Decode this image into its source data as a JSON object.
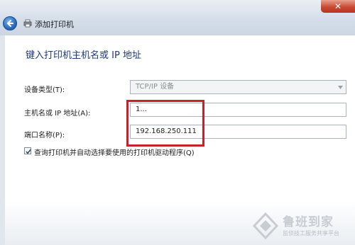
{
  "window": {
    "title": "添加打印机",
    "close_glyph": "✕"
  },
  "page": {
    "heading": "键入打印机主机名或 IP 地址"
  },
  "form": {
    "device_type": {
      "label": "设备类型(T):",
      "value": "TCP/IP 设备"
    },
    "hostname": {
      "label": "主机名或 IP 地址(A):",
      "value": "1..."
    },
    "port_name": {
      "label": "端口名称(P):",
      "value": "192.168.250.111"
    },
    "auto_detect": {
      "label": "查询打印机并自动选择要使用的打印机驱动程序(Q)",
      "checked": true
    }
  },
  "watermark": {
    "title": "鲁班到家",
    "subtitle": "监侦技工服务共享平台"
  },
  "colors": {
    "highlight": "#c8212c",
    "heading": "#1e3a78"
  },
  "icons": {
    "back": "back-arrow-icon",
    "printer": "printer-icon",
    "check": "checkmark-icon",
    "dropdown": "chevron-down-icon"
  }
}
